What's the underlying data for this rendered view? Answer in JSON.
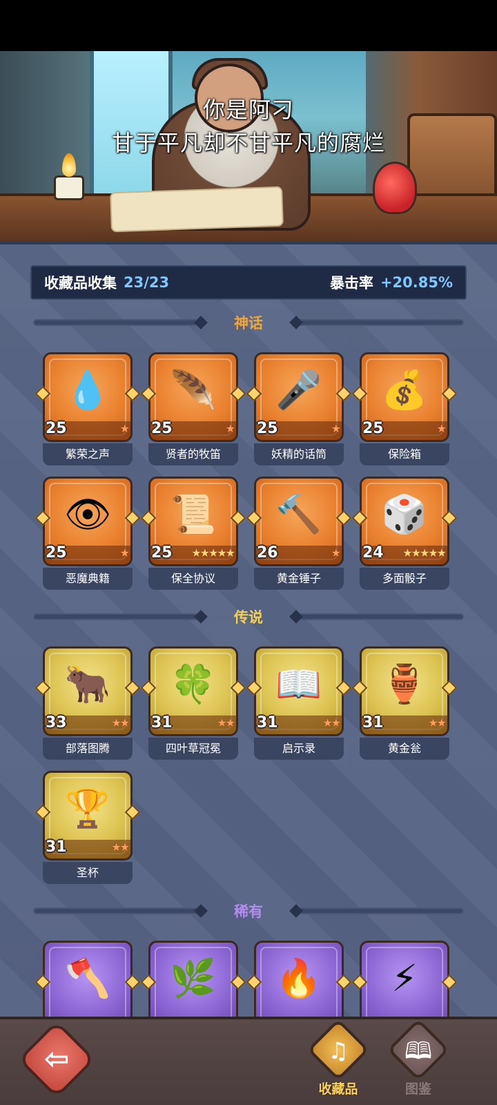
{
  "banner": {
    "line1": "你是阿刁",
    "line2": "甘于平凡却不甘平凡的腐烂"
  },
  "summary": {
    "collection_label": "收藏品收集",
    "collection_count": "23/23",
    "crit_label": "暴击率",
    "crit_value": "+20.85%"
  },
  "sections": {
    "mythic": "神话",
    "legend": "传说",
    "rare": "稀有"
  },
  "colors": {
    "mythic_title": "#f1a63c",
    "legend_title": "#f2cf52",
    "rare_title": "#b48cf0"
  },
  "mythic_items": [
    {
      "name": "繁荣之声",
      "level": "25",
      "stars": 1,
      "icon": "blue-spirit-icon"
    },
    {
      "name": "贤者的牧笛",
      "level": "25",
      "stars": 1,
      "icon": "flute-icon"
    },
    {
      "name": "妖精的话筒",
      "level": "25",
      "stars": 1,
      "icon": "fairy-microphone-icon"
    },
    {
      "name": "保险箱",
      "level": "25",
      "stars": 1,
      "icon": "treasure-chest-icon"
    },
    {
      "name": "恶魔典籍",
      "level": "25",
      "stars": 1,
      "icon": "demon-book-icon"
    },
    {
      "name": "保全协议",
      "level": "25",
      "stars": 5,
      "icon": "contract-scroll-icon"
    },
    {
      "name": "黄金锤子",
      "level": "26",
      "stars": 1,
      "icon": "golden-hammer-icon"
    },
    {
      "name": "多面骰子",
      "level": "24",
      "stars": 5,
      "icon": "dice-icon"
    }
  ],
  "legend_items": [
    {
      "name": "部落图腾",
      "level": "33",
      "stars": 2,
      "icon": "totem-icon"
    },
    {
      "name": "四叶草冠冕",
      "level": "31",
      "stars": 2,
      "icon": "clover-crown-icon"
    },
    {
      "name": "启示录",
      "level": "31",
      "stars": 2,
      "icon": "open-book-icon"
    },
    {
      "name": "黄金瓮",
      "level": "31",
      "stars": 2,
      "icon": "golden-urn-icon"
    },
    {
      "name": "圣杯",
      "level": "31",
      "stars": 2,
      "icon": "holy-grail-icon"
    }
  ],
  "rare_items": [
    {
      "icon": "axe-icon"
    },
    {
      "icon": "vine-chain-icon"
    },
    {
      "icon": "flame-scepter-icon"
    },
    {
      "icon": "lightning-card-icon"
    }
  ],
  "bottom_nav": {
    "back_icon": "back-arrow-icon",
    "collection_label": "收藏品",
    "codex_label": "图鉴"
  }
}
